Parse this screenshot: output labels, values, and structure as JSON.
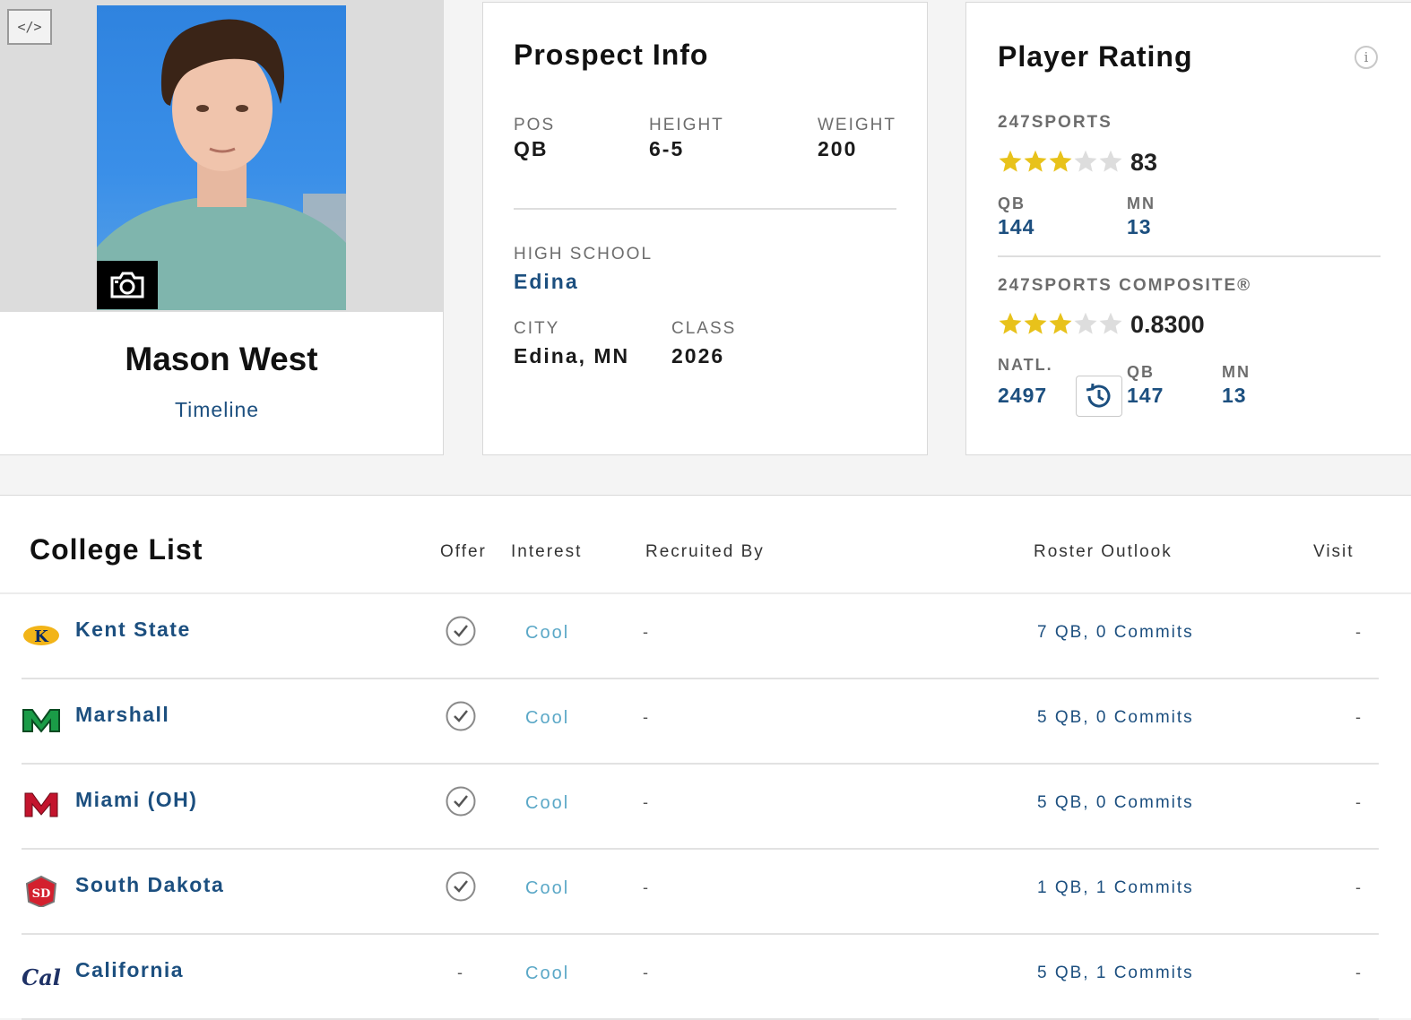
{
  "player": {
    "name": "Mason West",
    "timeline_label": "Timeline",
    "embed_label": "</>",
    "embed_icon": "code-icon",
    "camera_icon": "camera-icon"
  },
  "prospect": {
    "title": "Prospect Info",
    "pos_label": "POS",
    "pos": "QB",
    "height_label": "HEIGHT",
    "height": "6-5",
    "weight_label": "WEIGHT",
    "weight": "200",
    "high_school_label": "HIGH SCHOOL",
    "high_school": "Edina",
    "city_label": "CITY",
    "city": "Edina, MN",
    "class_label": "CLASS",
    "class": "2026"
  },
  "rating": {
    "title": "Player Rating",
    "info_label": "i",
    "sports247": {
      "label": "247SPORTS",
      "stars": 3,
      "score": "83",
      "pos_rank_label": "QB",
      "pos_rank": "144",
      "state_rank_label": "MN",
      "state_rank": "13"
    },
    "composite": {
      "label": "247SPORTS COMPOSITE®",
      "stars": 3,
      "score": "0.8300",
      "natl_label": "NATL.",
      "natl_rank": "2497",
      "pos_rank_label": "QB",
      "pos_rank": "147",
      "state_rank_label": "MN",
      "state_rank": "13"
    },
    "star_color": "#e8c21b",
    "star_empty_color": "#dddddd"
  },
  "college_list": {
    "title": "College List",
    "columns": {
      "offer": "Offer",
      "interest": "Interest",
      "recruited_by": "Recruited By",
      "roster_outlook": "Roster Outlook",
      "visit": "Visit"
    },
    "rows": [
      {
        "school": "Kent State",
        "offer": true,
        "offer_text": "",
        "interest": "Cool",
        "recruited_by": "-",
        "roster": "7 QB, 0 Commits",
        "visit": "-"
      },
      {
        "school": "Marshall",
        "offer": true,
        "offer_text": "",
        "interest": "Cool",
        "recruited_by": "-",
        "roster": "5 QB, 0 Commits",
        "visit": "-"
      },
      {
        "school": "Miami (OH)",
        "offer": true,
        "offer_text": "",
        "interest": "Cool",
        "recruited_by": "-",
        "roster": "5 QB, 0 Commits",
        "visit": "-"
      },
      {
        "school": "South Dakota",
        "offer": true,
        "offer_text": "",
        "interest": "Cool",
        "recruited_by": "-",
        "roster": "1 QB, 1 Commits",
        "visit": "-"
      },
      {
        "school": "California",
        "offer": false,
        "offer_text": "-",
        "interest": "Cool",
        "recruited_by": "-",
        "roster": "5 QB, 1 Commits",
        "visit": "-"
      }
    ]
  }
}
